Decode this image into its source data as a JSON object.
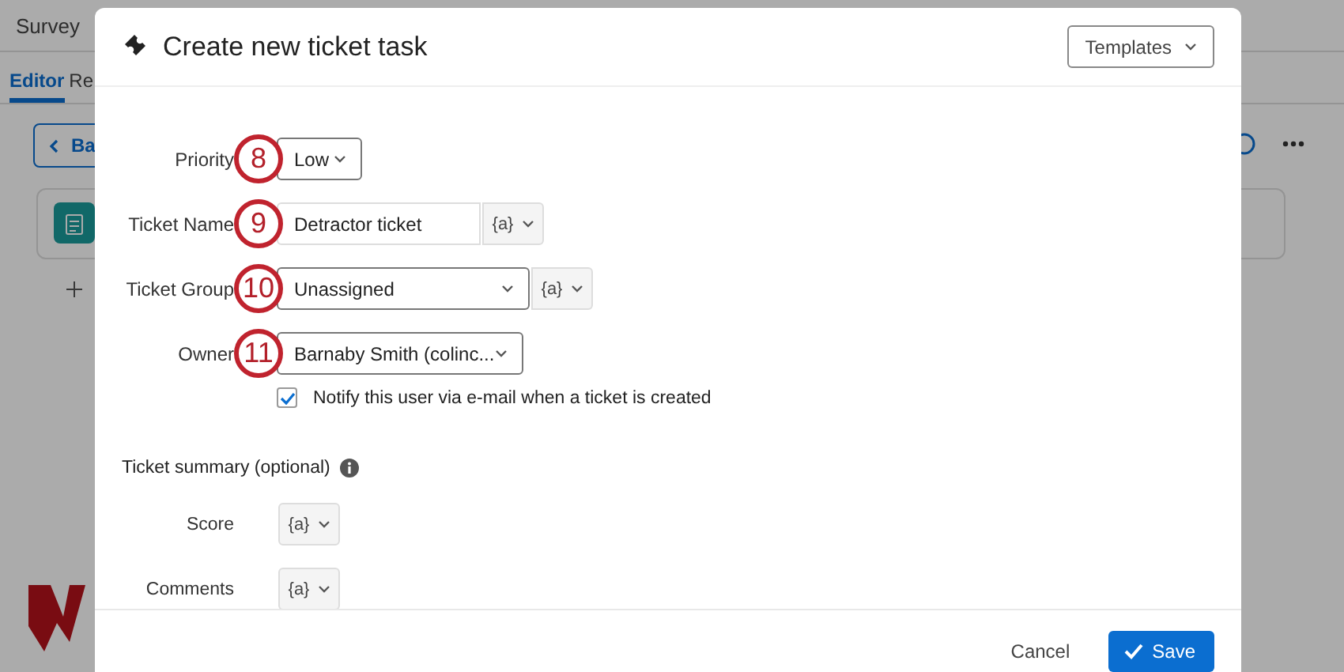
{
  "background": {
    "title": "Survey",
    "tabs": [
      {
        "label": "Editor",
        "selected": true
      },
      {
        "label": "Re",
        "selected": false
      }
    ],
    "back_button": "Ba"
  },
  "dialog": {
    "title": "Create new ticket task",
    "templates_button": "Templates",
    "fields": [
      {
        "kind": "select",
        "label": "Priority",
        "step": "8",
        "value": "Low"
      },
      {
        "kind": "text",
        "label": "Ticket Name",
        "step": "9",
        "value": "Detractor ticket",
        "piped": "{a}"
      },
      {
        "kind": "select",
        "label": "Ticket Group",
        "step": "10",
        "value": "Unassigned",
        "piped": "{a}"
      },
      {
        "kind": "select",
        "label": "Owner",
        "step": "11",
        "value": "Barnaby Smith (colinc..."
      }
    ],
    "notify": {
      "label": "Notify this user via e-mail when a ticket is created",
      "checked": true
    },
    "summary": {
      "title": "Ticket summary (optional)",
      "rows": [
        {
          "label": "Score",
          "piped": "{a}"
        },
        {
          "label": "Comments",
          "piped": "{a}"
        }
      ]
    },
    "buttons": {
      "cancel": "Cancel",
      "save": "Save"
    }
  }
}
